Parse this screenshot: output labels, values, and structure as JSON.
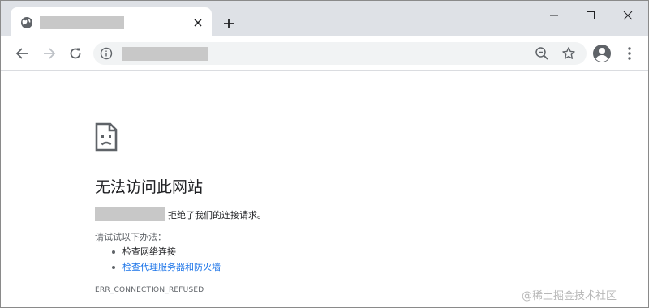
{
  "browser": {
    "tab": {
      "title": "",
      "globe_icon": "globe-icon",
      "close_icon": "close-icon"
    },
    "new_tab_icon": "plus-icon",
    "window_controls": [
      "minimize-icon",
      "maximize-icon",
      "close-icon"
    ],
    "toolbar": {
      "back_icon": "arrow-left-icon",
      "forward_icon": "arrow-right-icon",
      "reload_icon": "reload-icon",
      "address": "",
      "site_info_icon": "info-icon",
      "zoom_icon": "zoom-out-icon",
      "bookmark_icon": "star-icon",
      "profile_icon": "account-circle-icon",
      "menu_icon": "kebab-menu-icon"
    }
  },
  "error_page": {
    "icon": "sad-document-icon",
    "title": "无法访问此网站",
    "host": "",
    "refused_message": "拒绝了我们的连接请求。",
    "try_label": "请试试以下办法：",
    "suggestions": [
      {
        "text": "检查网络连接",
        "is_link": false
      },
      {
        "text": "检查代理服务器和防火墙",
        "is_link": true
      }
    ],
    "error_code": "ERR_CONNECTION_REFUSED"
  },
  "watermark": "@稀土掘金技术社区",
  "colors": {
    "tab_strip": "#dee1e6",
    "omnibox": "#f1f3f4",
    "link": "#1a73e8",
    "text": "#202124",
    "secondary_text": "#5f6368",
    "icon": "#5f6368"
  }
}
